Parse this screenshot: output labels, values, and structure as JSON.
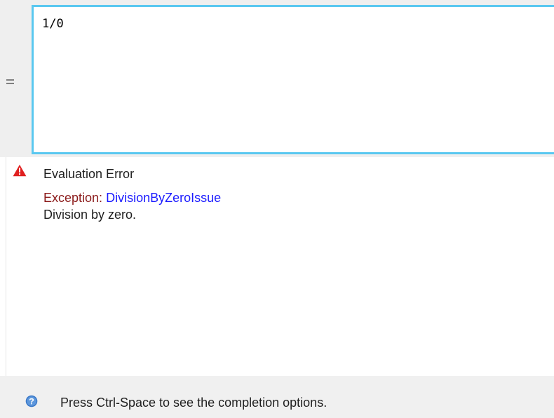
{
  "editor": {
    "expression": "1/0"
  },
  "result": {
    "title": "Evaluation Error",
    "exception_label": "Exception:",
    "exception_type": "DivisionByZeroIssue",
    "message": "Division by zero."
  },
  "status": {
    "hint": "Press Ctrl-Space to see the completion options."
  },
  "icons": {
    "equals_marker": "equals-icon",
    "warning": "warning-icon",
    "help": "help-icon"
  },
  "colors": {
    "editor_focus_border": "#5ac8f0",
    "warning_red": "#e02020",
    "exception_label": "#8b1a1a",
    "exception_link": "#1a1aff",
    "help_blue": "#3a78c8"
  }
}
